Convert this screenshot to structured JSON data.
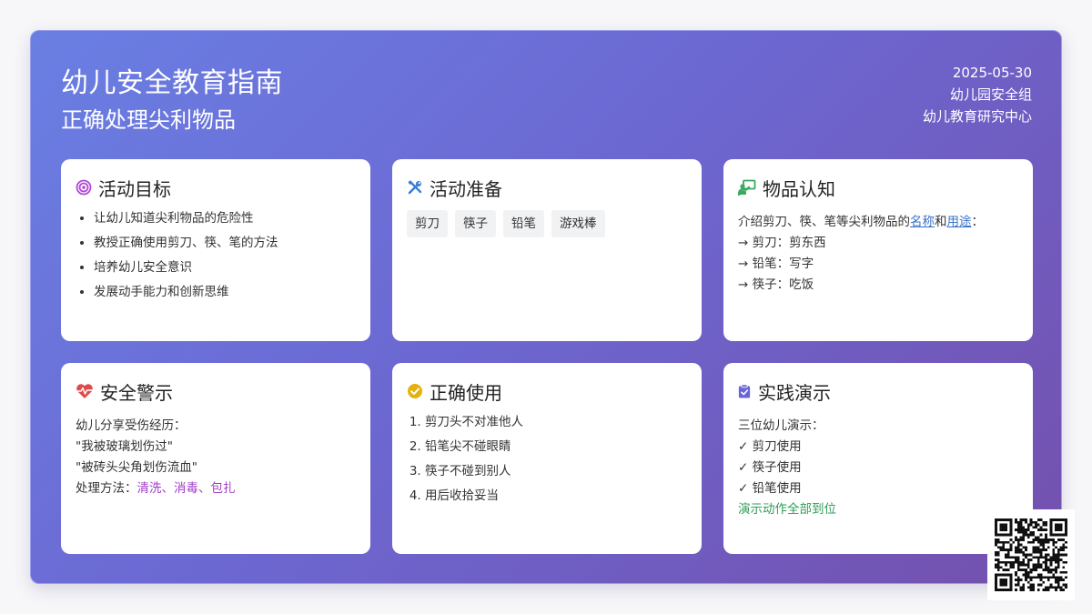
{
  "header": {
    "title": "幼儿安全教育指南",
    "subtitle": "正确处理尖利物品",
    "date": "2025-05-30",
    "group": "幼儿园安全组",
    "org": "幼儿教育研究中心"
  },
  "cards": {
    "goals": {
      "title": "活动目标",
      "icon": "target-icon",
      "items": [
        "让幼儿知道尖利物品的危险性",
        "教授正确使用剪刀、筷、笔的方法",
        "培养幼儿安全意识",
        "发展动手能力和创新思维"
      ]
    },
    "prep": {
      "title": "活动准备",
      "icon": "tools-icon",
      "tags": [
        "剪刀",
        "筷子",
        "铅笔",
        "游戏棒"
      ]
    },
    "recognition": {
      "title": "物品认知",
      "icon": "teacher-icon",
      "intro_prefix": "介绍剪刀、筷、笔等尖利物品的",
      "link_name": "名称",
      "and_text": "和",
      "link_use": "用途",
      "intro_suffix": "：",
      "lines": [
        "→ 剪刀：剪东西",
        "→ 铅笔：写字",
        "→ 筷子：吃饭"
      ]
    },
    "warning": {
      "title": "安全警示",
      "icon": "heart-pulse-icon",
      "lines": [
        "幼儿分享受伤经历：",
        "\"我被玻璃划伤过\"",
        "\"被砖头尖角划伤流血\""
      ],
      "method_prefix": "处理方法：",
      "method": "清洗、消毒、包扎"
    },
    "usage": {
      "title": "正确使用",
      "icon": "check-circle-icon",
      "steps": [
        "剪刀头不对准他人",
        "铅笔尖不碰眼睛",
        "筷子不碰到别人",
        "用后收拾妥当"
      ]
    },
    "demo": {
      "title": "实践演示",
      "icon": "clipboard-check-icon",
      "intro": "三位幼儿演示：",
      "lines": [
        "✓ 剪刀使用",
        "✓ 筷子使用",
        "✓ 铅笔使用"
      ],
      "result": "演示动作全部到位"
    }
  },
  "colors": {
    "gradient_start": "#6a7fe3",
    "gradient_end": "#7450ad",
    "link": "#3a73c9",
    "purple_text": "#a23dc8",
    "green_text": "#2f9c55",
    "goal_icon": "#b04ad6",
    "tools_icon": "#3a7fd5",
    "teacher_icon": "#3aaa5c",
    "heart_icon": "#e04a4a",
    "check_icon": "#e6b10f",
    "clipboard_icon": "#6b64d8"
  }
}
